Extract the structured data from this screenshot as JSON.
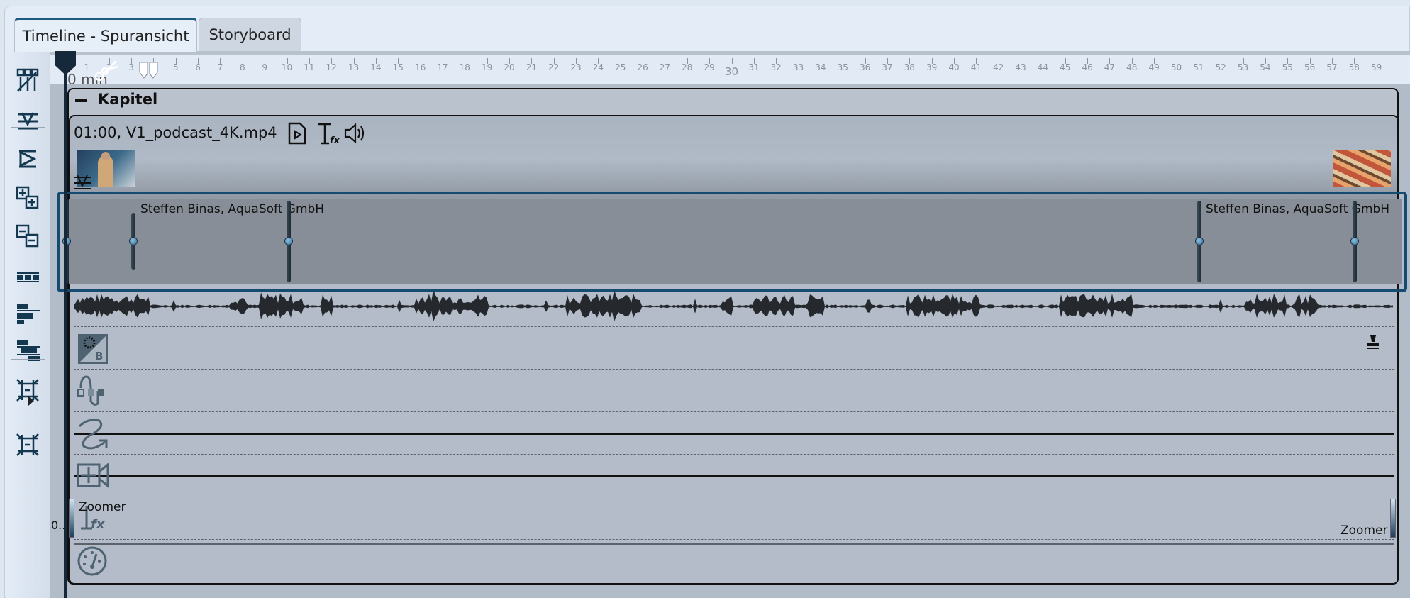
{
  "tabs": [
    {
      "label": "Timeline - Spuransicht",
      "active": true
    },
    {
      "label": "Storyboard",
      "active": false
    }
  ],
  "ruler": {
    "zero_label": "0 min",
    "ticks": [
      "1",
      "2",
      "3",
      "4",
      "5",
      "6",
      "7",
      "8",
      "9",
      "10",
      "11",
      "12",
      "13",
      "14",
      "15",
      "16",
      "17",
      "18",
      "19",
      "20",
      "21",
      "22",
      "23",
      "24",
      "25",
      "26",
      "27",
      "28",
      "29",
      "30",
      "31",
      "32",
      "33",
      "34",
      "35",
      "36",
      "37",
      "38",
      "39",
      "40",
      "41",
      "42",
      "43",
      "44",
      "45",
      "46",
      "47",
      "48",
      "49",
      "50",
      "51",
      "52",
      "53",
      "54",
      "55",
      "56",
      "57",
      "58",
      "59"
    ]
  },
  "toolbar": {
    "icons": [
      "timeline-tracks-icon",
      "insert-marker-icon",
      "align-icon",
      "expand-all-icon",
      "collapse-all-icon",
      "filmstrip-icon",
      "align-left-icon",
      "align-stagger-icon",
      "fit-compress-icon",
      "fit-expand-icon"
    ]
  },
  "chapter": {
    "title": "Kapitel"
  },
  "clip": {
    "title": "01:00, V1_podcast_4K.mp4",
    "volume_labels": [
      "Steffen Binas, AquaSoft GmbH",
      "Steffen Binas, AquaSoft GmbH"
    ],
    "zoomer_left": "Zoomer",
    "zoomer_right": "Zoomer",
    "zoomer_value": "0..."
  },
  "colors": {
    "selection": "#154b70",
    "track": "#b2bcc8",
    "playhead": "#15293a"
  }
}
